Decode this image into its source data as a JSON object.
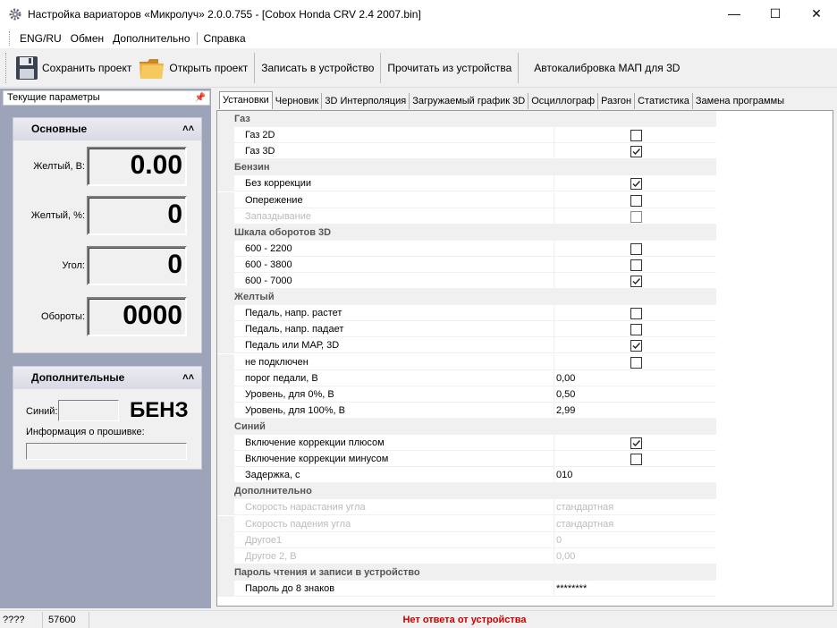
{
  "window": {
    "title": "Настройка вариаторов «Микролуч» 2.0.0.755 - [Cobox Honda CRV 2.4 2007.bin]",
    "minimize": "—",
    "maximize": "☐",
    "close": "✕"
  },
  "menu": [
    "ENG/RU",
    "Обмен",
    "Дополнительно",
    "Справка"
  ],
  "toolbar": {
    "save_project": "Сохранить проект",
    "open_project": "Открыть проект",
    "write_device": "Записать в устройство",
    "read_device": "Прочитать из устройства",
    "autocal": "Автокалибровка МАП для 3D"
  },
  "left": {
    "panel_title": "Текущие параметры",
    "main_group": "Основные",
    "yellow_v_label": "Желтый, В:",
    "yellow_v_value": "0.00",
    "yellow_pct_label": "Желтый, %:",
    "yellow_pct_value": "0",
    "angle_label": "Угол:",
    "angle_value": "0",
    "rpm_label": "Обороты:",
    "rpm_value": "0000",
    "extra_group": "Дополнительные",
    "blue_label": "Синий:",
    "fuel_mode": "БЕНЗ",
    "firmware_label": "Информация о прошивке:"
  },
  "tabs": [
    "Установки",
    "Черновик",
    "3D Интерполяция",
    "Загружаемый график 3D",
    "Осциллограф",
    "Разгон",
    "Статистика",
    "Замена программы"
  ],
  "rows": [
    {
      "type": "cat",
      "label": "Газ"
    },
    {
      "label": "Газ 2D",
      "check": false
    },
    {
      "label": "Газ 3D",
      "check": true
    },
    {
      "type": "cat",
      "label": "Бензин"
    },
    {
      "label": "Без коррекции",
      "check": true
    },
    {
      "label": "Опережение",
      "check": false
    },
    {
      "label": "Запаздывание",
      "check": false,
      "disabled": true
    },
    {
      "type": "cat",
      "label": "Шкала оборотов 3D"
    },
    {
      "label": "600 - 2200",
      "check": false
    },
    {
      "label": "600 - 3800",
      "check": false
    },
    {
      "label": "600 - 7000",
      "check": true
    },
    {
      "type": "cat",
      "label": "Желтый"
    },
    {
      "label": "Педаль, напр. растет",
      "check": false
    },
    {
      "label": "Педаль, напр. падает",
      "check": false
    },
    {
      "label": "Педаль или МАР, 3D",
      "check": true
    },
    {
      "label": "не подключен",
      "check": false
    },
    {
      "label": "порог педали, В",
      "value": "0,00"
    },
    {
      "label": "Уровень, для 0%, В",
      "value": "0,50"
    },
    {
      "label": "Уровень, для 100%, В",
      "value": "2,99"
    },
    {
      "type": "cat",
      "label": "Синий"
    },
    {
      "label": "Включение коррекции плюсом",
      "check": true
    },
    {
      "label": "Включение коррекции минусом",
      "check": false
    },
    {
      "label": "Задержка, с",
      "value": "010"
    },
    {
      "type": "cat",
      "label": "Дополнительно"
    },
    {
      "label": "Скорость нарастания угла",
      "value": "стандартная",
      "disabled": true
    },
    {
      "label": "Скорость падения угла",
      "value": "стандартная",
      "disabled": true
    },
    {
      "label": "Другое1",
      "value": "0",
      "disabled": true
    },
    {
      "label": "Другое 2, В",
      "value": "0,00",
      "disabled": true
    },
    {
      "type": "cat",
      "label": "Пароль чтения и записи в устройство"
    },
    {
      "label": "Пароль до 8 знаков",
      "value": "********"
    }
  ],
  "status": {
    "s1": "????",
    "s2": "57600",
    "message": "Нет ответа от устройства",
    "message_color": "#cc0000"
  }
}
